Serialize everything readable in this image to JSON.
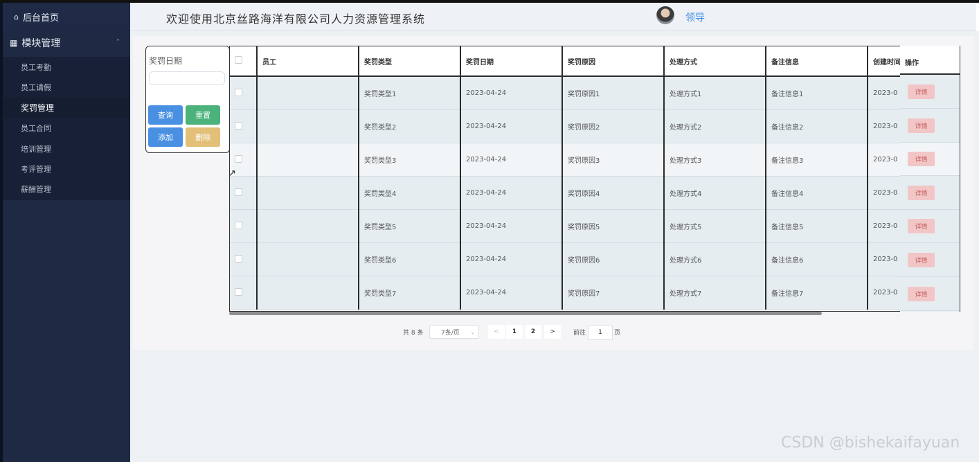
{
  "sidebar": {
    "home": "后台首页",
    "module": "模块管理",
    "items": [
      {
        "label": "员工考勤"
      },
      {
        "label": "员工请假"
      },
      {
        "label": "奖罚管理"
      },
      {
        "label": "员工合同"
      },
      {
        "label": "培训管理"
      },
      {
        "label": "考评管理"
      },
      {
        "label": "薪酬管理"
      }
    ]
  },
  "header": {
    "welcome": "欢迎使用北京丝路海洋有限公司人力资源管理系统",
    "username": "领导"
  },
  "search": {
    "label": "奖罚日期",
    "value": "",
    "query": "查询",
    "reset": "重置",
    "add": "添加",
    "delete": "删除"
  },
  "table": {
    "headers": [
      "员工",
      "奖罚类型",
      "奖罚日期",
      "奖罚原因",
      "处理方式",
      "备注信息",
      "创建时间",
      "操作"
    ],
    "rows": [
      {
        "employee": "",
        "type": "奖罚类型1",
        "date": "2023-04-24",
        "reason": "奖罚原因1",
        "method": "处理方式1",
        "note": "备注信息1",
        "created": "2023-0"
      },
      {
        "employee": "",
        "type": "奖罚类型2",
        "date": "2023-04-24",
        "reason": "奖罚原因2",
        "method": "处理方式2",
        "note": "备注信息2",
        "created": "2023-0"
      },
      {
        "employee": "",
        "type": "奖罚类型3",
        "date": "2023-04-24",
        "reason": "奖罚原因3",
        "method": "处理方式3",
        "note": "备注信息3",
        "created": "2023-0"
      },
      {
        "employee": "",
        "type": "奖罚类型4",
        "date": "2023-04-24",
        "reason": "奖罚原因4",
        "method": "处理方式4",
        "note": "备注信息4",
        "created": "2023-0"
      },
      {
        "employee": "",
        "type": "奖罚类型5",
        "date": "2023-04-24",
        "reason": "奖罚原因5",
        "method": "处理方式5",
        "note": "备注信息5",
        "created": "2023-0"
      },
      {
        "employee": "",
        "type": "奖罚类型6",
        "date": "2023-04-24",
        "reason": "奖罚原因6",
        "method": "处理方式6",
        "note": "备注信息6",
        "created": "2023-0"
      },
      {
        "employee": "",
        "type": "奖罚类型7",
        "date": "2023-04-24",
        "reason": "奖罚原因7",
        "method": "处理方式7",
        "note": "备注信息7",
        "created": "2023-0"
      }
    ],
    "detail": "详情"
  },
  "pagination": {
    "total": "共 8 条",
    "page_size": "7条/页",
    "pages": [
      "1",
      "2"
    ],
    "goto": "前往",
    "current": "1",
    "page_suffix": "页"
  },
  "watermark": "CSDN @bishekaifayuan",
  "colors": {
    "sidebar_bg": "#1e2a44",
    "primary": "#4a90e2",
    "success": "#4cb27c",
    "warning": "#e2c078",
    "detail_btn": "#f2c6c6"
  }
}
